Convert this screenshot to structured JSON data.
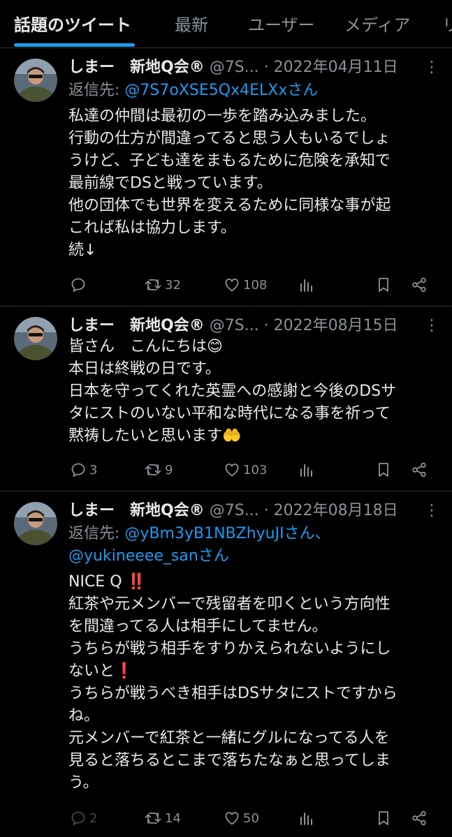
{
  "tabs": [
    "話題のツイート",
    "最新",
    "ユーザー",
    "メディア",
    "リ"
  ],
  "tweets": [
    {
      "name": "しまー　新地Q会®",
      "handle": "@7S...",
      "date": "· 2022年04月11日",
      "reply_label": "返信先:",
      "reply_to": [
        "@7S7oXSE5Qx4ELXxさん"
      ],
      "body": [
        "私達の仲間は最初の一歩を踏み込みました。",
        "行動の仕方が間違ってると思う人もいるでしょ",
        "うけど、子ども達をまもるために危険を承知で",
        "最前線でDSと戦っています。",
        "他の団体でも世界を変えるために同様な事が起",
        "これば私は協力します。",
        "続↓"
      ],
      "replies": "",
      "retweets": "32",
      "likes": "108"
    },
    {
      "name": "しまー　新地Q会®",
      "handle": "@7S...",
      "date": "· 2022年08月15日",
      "reply_label": "",
      "reply_to": [],
      "body": [
        "皆さん　こんにちは😊",
        "本日は終戦の日です。",
        "日本を守ってくれた英霊への感謝と今後のDSサ",
        "タにストのいない平和な時代になる事を祈って",
        "黙祷したいと思います🤲"
      ],
      "replies": "3",
      "retweets": "9",
      "likes": "103"
    },
    {
      "name": "しまー　新地Q会®",
      "handle": "@7S...",
      "date": "· 2022年08月18日",
      "reply_label": "返信先:",
      "reply_to": [
        "@yBm3yB1NBZhyuJIさん、",
        "@yukineeee_sanさん"
      ],
      "body": [
        "NICE Q ‼️",
        "紅茶や元メンバーで残留者を叩くという方向性",
        "を間違ってる人は相手にしてません。",
        "うちらが戦う相手をすりかえられないようにし",
        "ないと❗️",
        "うちらが戦うべき相手はDSサタにストですから",
        "ね。",
        "元メンバーで紅茶と一緒にグルになってる人を",
        "見ると落ちるとこまで落ちたなぁと思ってしま",
        "う。"
      ],
      "replies": "2",
      "retweets": "14",
      "likes": "50"
    }
  ],
  "colors": {
    "background": "#000000",
    "text": "#e7e9ea",
    "muted": "#8b9298",
    "link": "#1d9bf0",
    "divider": "#2f3336"
  }
}
